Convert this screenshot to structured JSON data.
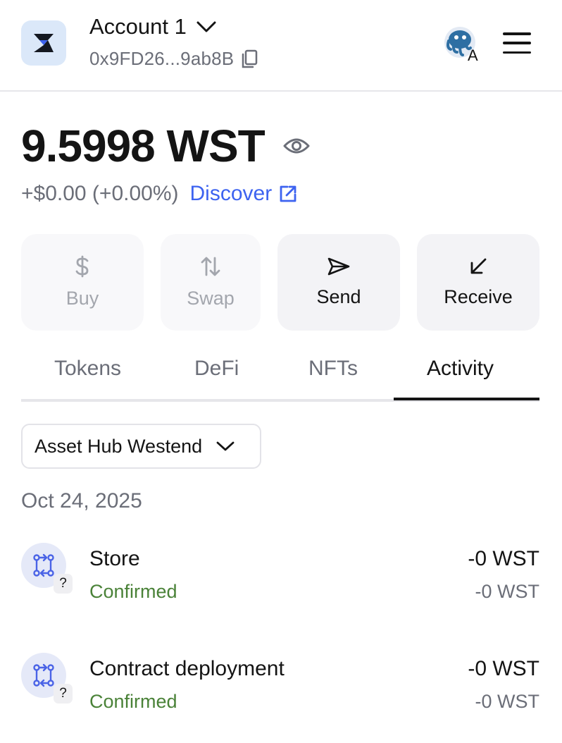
{
  "header": {
    "account_name": "Account 1",
    "address": "0x9FD26...9ab8B",
    "avatar_badge": "A"
  },
  "balance": {
    "amount": "9.5998 WST",
    "change": "+$0.00 (+0.00%)",
    "discover_label": "Discover"
  },
  "actions": [
    {
      "label": "Buy",
      "icon": "dollar-icon",
      "enabled": false
    },
    {
      "label": "Swap",
      "icon": "swap-arrows-icon",
      "enabled": false
    },
    {
      "label": "Send",
      "icon": "send-icon",
      "enabled": true
    },
    {
      "label": "Receive",
      "icon": "receive-arrow-icon",
      "enabled": true
    }
  ],
  "tabs": [
    {
      "label": "Tokens",
      "active": false
    },
    {
      "label": "DeFi",
      "active": false
    },
    {
      "label": "NFTs",
      "active": false
    },
    {
      "label": "Activity",
      "active": true
    }
  ],
  "network_filter": {
    "value": "Asset Hub Westend"
  },
  "activity": {
    "date": "Oct 24, 2025",
    "items": [
      {
        "title": "Store",
        "status": "Confirmed",
        "amount": "-0 WST",
        "sub_amount": "-0 WST",
        "badge": "?"
      },
      {
        "title": "Contract deployment",
        "status": "Confirmed",
        "amount": "-0 WST",
        "sub_amount": "-0 WST",
        "badge": "?"
      }
    ]
  },
  "colors": {
    "accent": "#3d63f0",
    "confirmed": "#4a8238",
    "muted": "#6b6e78"
  }
}
